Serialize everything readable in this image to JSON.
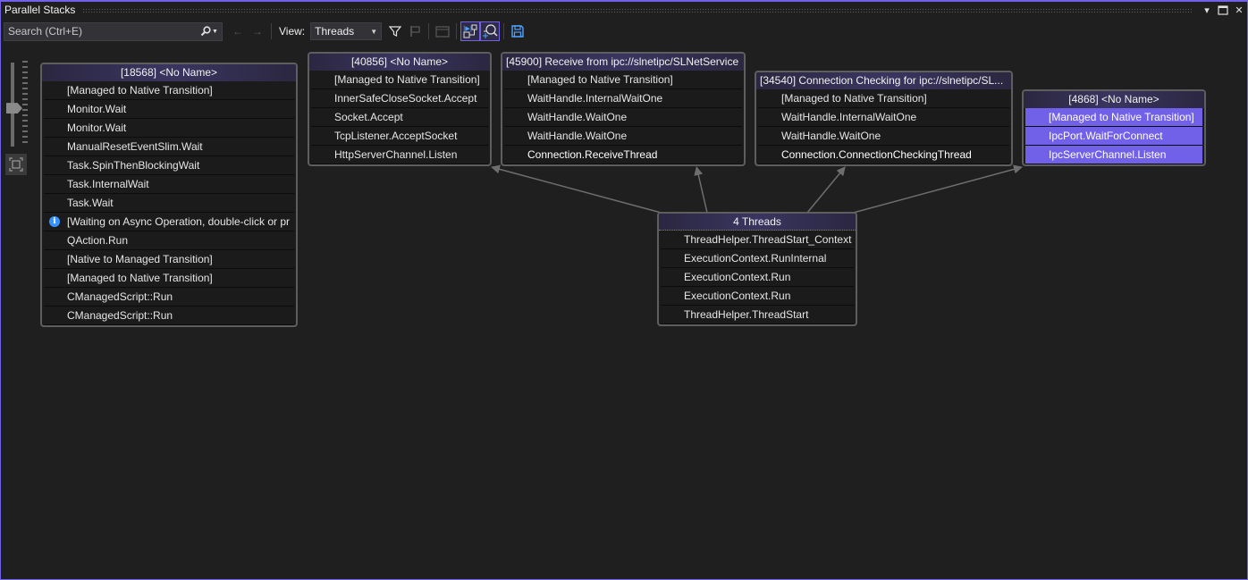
{
  "window": {
    "title": "Parallel Stacks",
    "buttons": {
      "dropdown": "▾",
      "maximize": "□",
      "close": "✕"
    }
  },
  "toolbar": {
    "search_placeholder": "Search (Ctrl+E)",
    "search_value": "",
    "search_icon": "search-icon",
    "back_icon": "←",
    "forward_icon": "→",
    "view_label": "View:",
    "view_selected": "Threads",
    "icons": [
      "filter-icon",
      "flag-icon",
      "show-external-code-icon",
      "toggle-method-view-icon",
      "auto-scroll-icon",
      "save-icon"
    ]
  },
  "zoom": {
    "level": 0.45
  },
  "nodes": [
    {
      "id": "n18568",
      "header": "[18568] <No Name>",
      "frames": [
        {
          "text": "[Managed to Native Transition]"
        },
        {
          "text": "Monitor.Wait"
        },
        {
          "text": "Monitor.Wait"
        },
        {
          "text": "ManualResetEventSlim.Wait"
        },
        {
          "text": "Task.SpinThenBlockingWait"
        },
        {
          "text": "Task.InternalWait"
        },
        {
          "text": "Task.Wait"
        },
        {
          "text": "[Waiting on Async Operation, double-click or pr",
          "info": true
        },
        {
          "text": "QAction.Run"
        },
        {
          "text": "[Native to Managed Transition]"
        },
        {
          "text": "[Managed to Native Transition]"
        },
        {
          "text": "CManagedScript::Run"
        },
        {
          "text": "CManagedScript::Run"
        }
      ]
    },
    {
      "id": "n40856",
      "header": "[40856] <No Name>",
      "frames": [
        {
          "text": "[Managed to Native Transition]"
        },
        {
          "text": "InnerSafeCloseSocket.Accept"
        },
        {
          "text": "Socket.Accept"
        },
        {
          "text": "TcpListener.AcceptSocket"
        },
        {
          "text": "HttpServerChannel.Listen"
        }
      ]
    },
    {
      "id": "n45900",
      "header": "[45900] Receive from ipc://slnetipc/SLNetService",
      "frames": [
        {
          "text": "[Managed to Native Transition]"
        },
        {
          "text": "WaitHandle.InternalWaitOne"
        },
        {
          "text": "WaitHandle.WaitOne"
        },
        {
          "text": "WaitHandle.WaitOne"
        },
        {
          "text": "Connection.ReceiveThread",
          "bold": true
        }
      ]
    },
    {
      "id": "n34540",
      "header": "[34540] Connection Checking for ipc://slnetipc/SL...",
      "frames": [
        {
          "text": "[Managed to Native Transition]"
        },
        {
          "text": "WaitHandle.InternalWaitOne"
        },
        {
          "text": "WaitHandle.WaitOne"
        },
        {
          "text": "Connection.ConnectionCheckingThread",
          "bold": true
        }
      ]
    },
    {
      "id": "n4868",
      "header": "[4868] <No Name>",
      "frames": [
        {
          "text": "[Managed to Native Transition]",
          "selected": true
        },
        {
          "text": "IpcPort.WaitForConnect",
          "selected": true
        },
        {
          "text": "IpcServerChannel.Listen",
          "selected": true
        }
      ]
    },
    {
      "id": "nroot",
      "header": "4 Threads",
      "frames": [
        {
          "text": "ThreadHelper.ThreadStart_Context"
        },
        {
          "text": "ExecutionContext.RunInternal"
        },
        {
          "text": "ExecutionContext.Run"
        },
        {
          "text": "ExecutionContext.Run"
        },
        {
          "text": "ThreadHelper.ThreadStart"
        }
      ]
    }
  ],
  "edges": [
    {
      "from": "nroot",
      "to": "n40856"
    },
    {
      "from": "nroot",
      "to": "n45900"
    },
    {
      "from": "nroot",
      "to": "n34540"
    },
    {
      "from": "nroot",
      "to": "n4868"
    }
  ],
  "colors": {
    "accent": "#7160e8",
    "background": "#1f1f1f",
    "node_border": "#5e5e5e",
    "edge": "#6e6e6e",
    "info": "#3794ff"
  }
}
